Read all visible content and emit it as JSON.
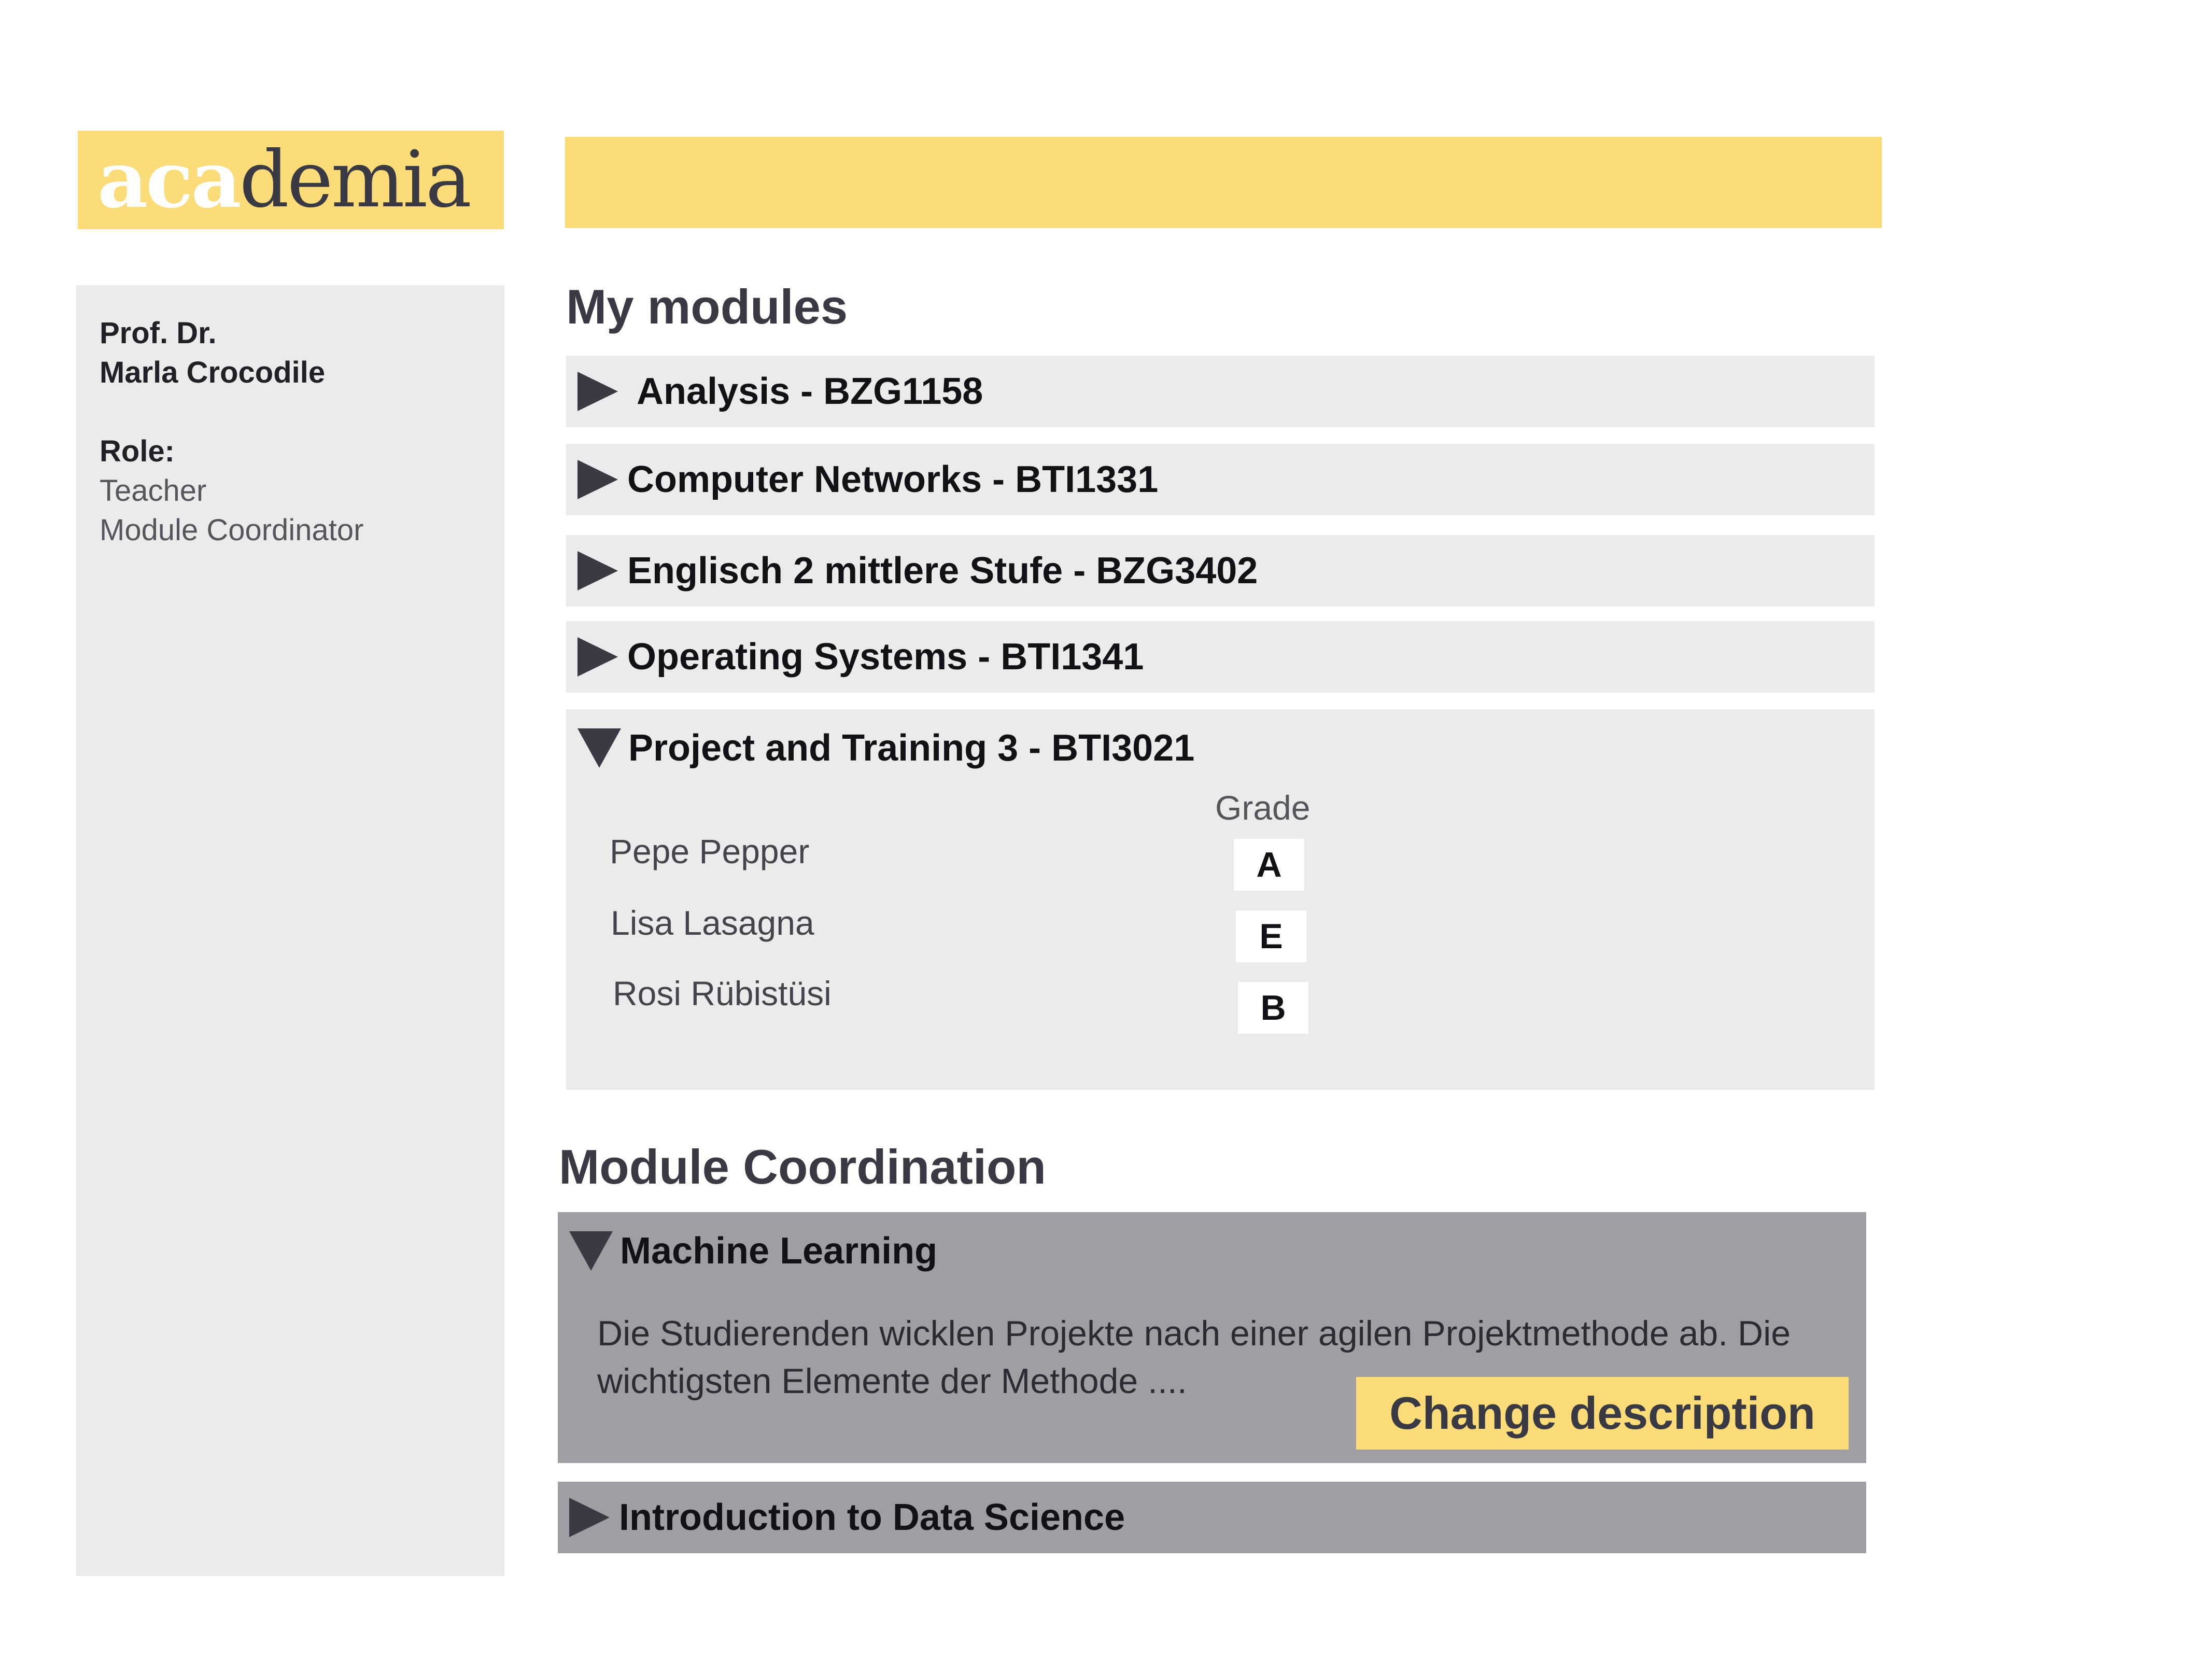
{
  "logo": {
    "part1": "aca",
    "part2": "demia"
  },
  "sidebar": {
    "title_line1": "Prof. Dr.",
    "title_line2": "Marla Crocodile",
    "role_label": "Role:",
    "roles": [
      "Teacher",
      "Module Coordinator"
    ]
  },
  "my_modules": {
    "title": "My modules",
    "modules": [
      {
        "label": "Analysis - BZG1158",
        "expanded": false
      },
      {
        "label": "Computer Networks - BTI1331",
        "expanded": false
      },
      {
        "label": "Englisch 2 mittlere Stufe - BZG3402",
        "expanded": false
      },
      {
        "label": "Operating Systems - BTI1341",
        "expanded": false
      },
      {
        "label": "Project and Training 3 - BTI3021",
        "expanded": true
      }
    ],
    "grade_header": "Grade",
    "students": [
      {
        "name": "Pepe Pepper",
        "grade": "A"
      },
      {
        "name": "Lisa Lasagna",
        "grade": "E"
      },
      {
        "name": "Rosi Rübistüsi",
        "grade": "B"
      }
    ]
  },
  "coordination": {
    "title": "Module Coordination",
    "items": [
      {
        "label": "Machine Learning",
        "expanded": true,
        "description_line1": "Die Studierenden wicklen Projekte nach einer agilen Projektmethode ab. Die",
        "description_line2": "wichtigsten Elemente der Methode ....",
        "button": "Change description"
      },
      {
        "label": "Introduction to Data Science",
        "expanded": false
      }
    ]
  },
  "colors": {
    "accent_yellow": "#fcdc78",
    "panel_grey": "#ebebeb",
    "coord_grey": "#9e9ea3",
    "text_dark": "#3a3a44"
  },
  "icons": {
    "collapsed": "triangle-right-icon",
    "expanded": "triangle-down-icon"
  }
}
